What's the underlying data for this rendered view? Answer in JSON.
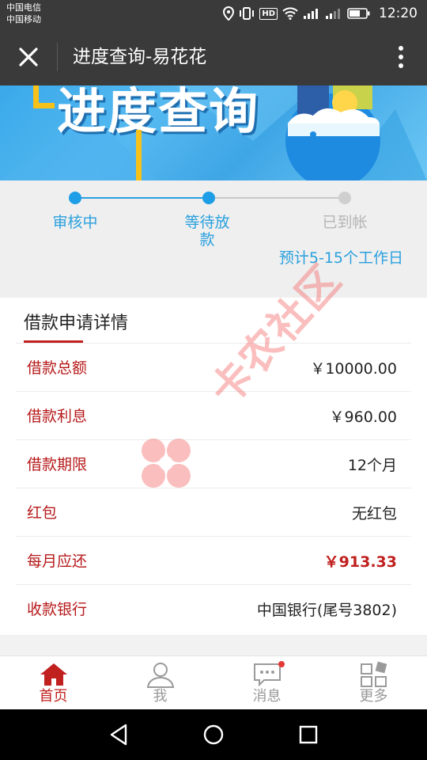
{
  "status_bar": {
    "carrier_1": "中国电信",
    "carrier_2": "中国移动",
    "hd_badge": "HD",
    "time": "12:20"
  },
  "titlebar": {
    "title": "进度查询-易花花"
  },
  "banner": {
    "title": "进度查询"
  },
  "progress": {
    "steps": [
      {
        "label": "审核中",
        "state": "done"
      },
      {
        "label": "等待放款",
        "state": "current"
      },
      {
        "label": "已到帐",
        "state": "pending"
      }
    ],
    "eta": "预计5-15个工作日"
  },
  "details": {
    "title": "借款申请详情",
    "rows": [
      {
        "label": "借款总额",
        "value": "￥10000.00"
      },
      {
        "label": "借款利息",
        "value": "￥960.00"
      },
      {
        "label": "借款期限",
        "value": "12个月"
      },
      {
        "label": "红包",
        "value": "无红包"
      },
      {
        "label": "每月应还",
        "value": "￥913.33"
      },
      {
        "label": "收款银行",
        "value": "中国银行(尾号3802)"
      }
    ]
  },
  "watermark": {
    "text": "卡农社区"
  },
  "tabbar": {
    "tabs": [
      {
        "label": "首页",
        "icon": "home-icon",
        "active": true
      },
      {
        "label": "我",
        "icon": "user-icon",
        "active": false
      },
      {
        "label": "消息",
        "icon": "message-icon",
        "active": false
      },
      {
        "label": "更多",
        "icon": "grid-icon",
        "active": false
      }
    ]
  },
  "colors": {
    "accent_red": "#c0201e",
    "progress_blue": "#2aa0de",
    "bar_dark": "#3a3a3a"
  }
}
